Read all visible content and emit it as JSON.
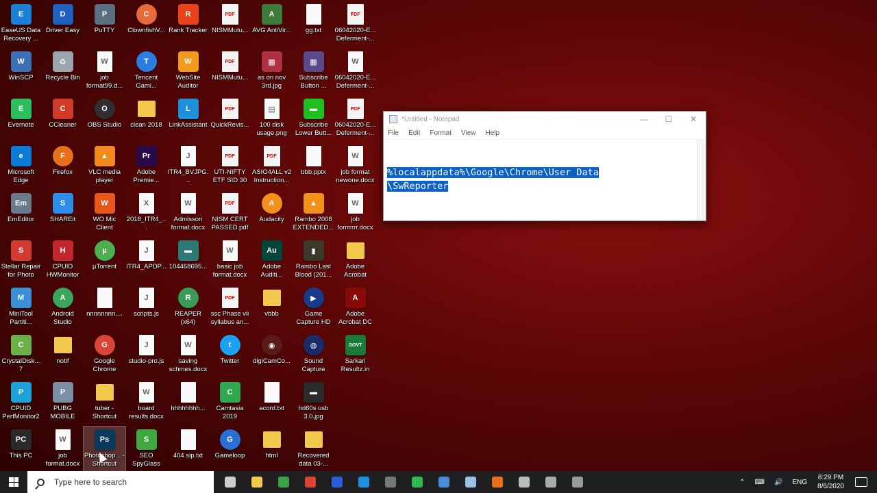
{
  "desktop_icons": [
    {
      "label": "EaseUS Data Recovery ...",
      "name": "easeus-icon",
      "type": "app",
      "color": "#1c7fd6",
      "glyph": "E"
    },
    {
      "label": "WinSCP",
      "name": "winscp-icon",
      "type": "app",
      "color": "#3b6fb6",
      "glyph": "W"
    },
    {
      "label": "Evernote",
      "name": "evernote-icon",
      "type": "app",
      "color": "#2dbe60",
      "glyph": "E"
    },
    {
      "label": "Microsoft Edge",
      "name": "edge-icon",
      "type": "app",
      "color": "#0c7bd8",
      "glyph": "e"
    },
    {
      "label": "EmEditor",
      "name": "emeditor-icon",
      "type": "app",
      "color": "#6a7a8c",
      "glyph": "Em"
    },
    {
      "label": "Stellar Repair for Photo",
      "name": "stellar-icon",
      "type": "app",
      "color": "#d23b2f",
      "glyph": "S"
    },
    {
      "label": "MiniTool Partiti...",
      "name": "minitool-icon",
      "type": "app",
      "color": "#3a8fd6",
      "glyph": "M"
    },
    {
      "label": "CrystalDisk... 7",
      "name": "crystaldisk-icon",
      "type": "app",
      "color": "#6cb04a",
      "glyph": "C"
    },
    {
      "label": "CPUID PerfMonitor2",
      "name": "perfmonitor-icon",
      "type": "app",
      "color": "#1ea3d8",
      "glyph": "P"
    },
    {
      "label": "This PC",
      "name": "this-pc-icon",
      "type": "app",
      "color": "#2a2a2a",
      "glyph": "PC"
    },
    {
      "label": "Driver Easy",
      "name": "drivereasy-icon",
      "type": "app",
      "color": "#1f5fbf",
      "glyph": "D"
    },
    {
      "label": "Recycle Bin",
      "name": "recycle-bin-icon",
      "type": "app",
      "color": "#9aa5b0",
      "glyph": "♻"
    },
    {
      "label": "CCleaner",
      "name": "ccleaner-icon",
      "type": "app",
      "color": "#d13a26",
      "glyph": "C"
    },
    {
      "label": "Firefox",
      "name": "firefox-icon",
      "type": "app",
      "color": "#e8701a",
      "glyph": "F",
      "round": true
    },
    {
      "label": "SHAREit",
      "name": "shareit-icon",
      "type": "app",
      "color": "#2d8fe8",
      "glyph": "S"
    },
    {
      "label": "CPUID HWMonitor",
      "name": "hwmonitor-icon",
      "type": "app",
      "color": "#c4262e",
      "glyph": "H"
    },
    {
      "label": "Android Studio",
      "name": "android-studio-icon",
      "type": "app",
      "color": "#3ca55c",
      "glyph": "A",
      "round": true
    },
    {
      "label": "notif",
      "name": "notif-icon",
      "type": "folder",
      "color": "#f2c94c",
      "glyph": ""
    },
    {
      "label": "PUBG MOBILE",
      "name": "pubg-icon",
      "type": "app",
      "color": "#7a8fa3",
      "glyph": "P"
    },
    {
      "label": "job format.docx",
      "name": "job-format-docx-icon",
      "type": "file",
      "color": "#fafafa",
      "glyph": "W"
    },
    {
      "label": "PuTTY",
      "name": "putty-icon",
      "type": "app",
      "color": "#5b6f82",
      "glyph": "P"
    },
    {
      "label": "job format99.d...",
      "name": "job-format99-icon",
      "type": "file",
      "color": "#fafafa",
      "glyph": "W"
    },
    {
      "label": "OBS Studio",
      "name": "obs-icon",
      "type": "app",
      "color": "#302e31",
      "glyph": "O",
      "round": true
    },
    {
      "label": "VLC media player",
      "name": "vlc-icon",
      "type": "app",
      "color": "#f08a1c",
      "glyph": "▲"
    },
    {
      "label": "WO Mic Client",
      "name": "womic-icon",
      "type": "app",
      "color": "#e8571a",
      "glyph": "W"
    },
    {
      "label": "µTorrent",
      "name": "utorrent-icon",
      "type": "app",
      "color": "#4caf50",
      "glyph": "µ",
      "round": true
    },
    {
      "label": "nnnnnnnn....",
      "name": "nnnnnnnn-icon",
      "type": "file",
      "color": "#fafafa",
      "glyph": ""
    },
    {
      "label": "Google Chrome",
      "name": "chrome-icon",
      "type": "app",
      "color": "#db4437",
      "glyph": "G",
      "round": true
    },
    {
      "label": "tuber - Shortcut",
      "name": "tuber-shortcut-icon",
      "type": "folder",
      "color": "#f2c94c",
      "glyph": ""
    },
    {
      "label": "Photoshop... - Shortcut",
      "name": "photoshop-shortcut-icon",
      "type": "app",
      "color": "#0a3a5c",
      "glyph": "Ps",
      "selected": true
    },
    {
      "label": "ClownfishV...",
      "name": "clownfish-icon",
      "type": "app",
      "color": "#e86a3a",
      "glyph": "C",
      "round": true
    },
    {
      "label": "Tencent Gami...",
      "name": "tencent-icon",
      "type": "app",
      "color": "#2a7de1",
      "glyph": "T",
      "round": true
    },
    {
      "label": "clean 2018",
      "name": "clean-2018-icon",
      "type": "folder",
      "color": "#f2c94c",
      "glyph": ""
    },
    {
      "label": "Adobe Premie...",
      "name": "premiere-icon",
      "type": "app",
      "color": "#2a0a4a",
      "glyph": "Pr"
    },
    {
      "label": "2018_ITR4_...",
      "name": "itr4-2018-icon",
      "type": "file",
      "color": "#fafafa",
      "glyph": "X"
    },
    {
      "label": "ITR4_APDP...",
      "name": "itr4-apdp-icon",
      "type": "file",
      "color": "#fafafa",
      "glyph": "J"
    },
    {
      "label": "scripts.js",
      "name": "scripts-js-icon",
      "type": "file",
      "color": "#fafafa",
      "glyph": "J"
    },
    {
      "label": "studio-pro.js",
      "name": "studio-pro-js-icon",
      "type": "file",
      "color": "#fafafa",
      "glyph": "J"
    },
    {
      "label": "board results.docx",
      "name": "board-results-icon",
      "type": "file",
      "color": "#fafafa",
      "glyph": "W"
    },
    {
      "label": "SEO SpyGlass",
      "name": "seo-spyglass-icon",
      "type": "app",
      "color": "#3fa83f",
      "glyph": "S"
    },
    {
      "label": "Rank Tracker",
      "name": "rank-tracker-icon",
      "type": "app",
      "color": "#e8431a",
      "glyph": "R"
    },
    {
      "label": "WebSite Auditor",
      "name": "website-auditor-icon",
      "type": "app",
      "color": "#f29a1c",
      "glyph": "W"
    },
    {
      "label": "LinkAssistant",
      "name": "linkassistant-icon",
      "type": "app",
      "color": "#1e8fd8",
      "glyph": "L"
    },
    {
      "label": "ITR4_BVJPG...",
      "name": "itr4-bvjpg-icon",
      "type": "file",
      "color": "#fafafa",
      "glyph": "J"
    },
    {
      "label": "Admisson format.docx",
      "name": "admission-format-icon",
      "type": "file",
      "color": "#fafafa",
      "glyph": "W"
    },
    {
      "label": "104468695...",
      "name": "file-104468695-icon",
      "type": "app",
      "color": "#2b7a78",
      "glyph": "▬"
    },
    {
      "label": "REAPER (x64)",
      "name": "reaper-icon",
      "type": "app",
      "color": "#3a9a5a",
      "glyph": "R",
      "round": true
    },
    {
      "label": "saving schmes.docx",
      "name": "saving-schmes-icon",
      "type": "file",
      "color": "#fafafa",
      "glyph": "W"
    },
    {
      "label": "hhhhhhhh...",
      "name": "hhhhhhhh-icon",
      "type": "file",
      "color": "#fafafa",
      "glyph": ""
    },
    {
      "label": "404 sip.txt",
      "name": "404-sip-txt-icon",
      "type": "file",
      "color": "#fafafa",
      "glyph": ""
    },
    {
      "label": "NISMMutu...",
      "name": "nism-mutu-1-icon",
      "type": "doc",
      "color": "#f4f4f4",
      "glyph": "PDF"
    },
    {
      "label": "NISMMutu...",
      "name": "nism-mutu-2-icon",
      "type": "doc",
      "color": "#f4f4f4",
      "glyph": "PDF"
    },
    {
      "label": "QuickRevis...",
      "name": "quickrevis-icon",
      "type": "doc",
      "color": "#f4f4f4",
      "glyph": "PDF"
    },
    {
      "label": "UTI-NIFTY ETF SID 30 ...",
      "name": "uti-nifty-icon",
      "type": "doc",
      "color": "#f4f4f4",
      "glyph": "PDF"
    },
    {
      "label": "NISM CERT PASSED.pdf",
      "name": "nism-cert-icon",
      "type": "doc",
      "color": "#f4f4f4",
      "glyph": "PDF"
    },
    {
      "label": "basic job format.docx",
      "name": "basic-job-format-icon",
      "type": "file",
      "color": "#fafafa",
      "glyph": "W"
    },
    {
      "label": "ssc Phase vii syllabus an...",
      "name": "ssc-phase-icon",
      "type": "doc",
      "color": "#f4f4f4",
      "glyph": "PDF"
    },
    {
      "label": "Twitter",
      "name": "twitter-icon",
      "type": "app",
      "color": "#1da1f2",
      "glyph": "t",
      "round": true
    },
    {
      "label": "Camtasia 2019",
      "name": "camtasia-icon",
      "type": "app",
      "color": "#2fa84f",
      "glyph": "C"
    },
    {
      "label": "Gameloop",
      "name": "gameloop-icon",
      "type": "app",
      "color": "#2a6fd8",
      "glyph": "G",
      "round": true
    },
    {
      "label": "AVG AntiVir...",
      "name": "avg-icon",
      "type": "app",
      "color": "#3f7a3a",
      "glyph": "A"
    },
    {
      "label": "as on nov 3rd.jpg",
      "name": "as-on-nov-icon",
      "type": "app",
      "color": "#b03040",
      "glyph": "▦"
    },
    {
      "label": "100 disk usage.png",
      "name": "disk-usage-icon",
      "type": "file",
      "color": "#fafafa",
      "glyph": "▤"
    },
    {
      "label": "ASIO4ALL v2 Instruction...",
      "name": "asio4all-icon",
      "type": "doc",
      "color": "#f4f4f4",
      "glyph": "PDF"
    },
    {
      "label": "Audacity",
      "name": "audacity-icon",
      "type": "app",
      "color": "#f2901c",
      "glyph": "A",
      "round": true
    },
    {
      "label": "Adobe Auditi...",
      "name": "audition-icon",
      "type": "app",
      "color": "#00463a",
      "glyph": "Au"
    },
    {
      "label": "vbbb",
      "name": "vbbb-icon",
      "type": "folder",
      "color": "#f2c94c",
      "glyph": ""
    },
    {
      "label": "digiCamCo...",
      "name": "digicam-icon",
      "type": "app",
      "color": "#5a1a1a",
      "glyph": "◉",
      "round": true
    },
    {
      "label": "acord.txt",
      "name": "acord-txt-icon",
      "type": "file",
      "color": "#fafafa",
      "glyph": ""
    },
    {
      "label": "html",
      "name": "html-folder-icon",
      "type": "folder",
      "color": "#f2c94c",
      "glyph": ""
    },
    {
      "label": "gg.txt",
      "name": "gg-txt-icon",
      "type": "file",
      "color": "#fafafa",
      "glyph": ""
    },
    {
      "label": "Subscribe Button ...",
      "name": "subscribe-button-icon",
      "type": "app",
      "color": "#5a4a8a",
      "glyph": "▦"
    },
    {
      "label": "Subscribe Lower Butt...",
      "name": "subscribe-lower-icon",
      "type": "app",
      "color": "#20c020",
      "glyph": "▬"
    },
    {
      "label": "bbb.pptx",
      "name": "bbb-pptx-icon",
      "type": "file",
      "color": "#fafafa",
      "glyph": ""
    },
    {
      "label": "Rambo 2008 EXTENDED...",
      "name": "rambo-2008-icon",
      "type": "app",
      "color": "#f2901c",
      "glyph": "▲"
    },
    {
      "label": "Rambo Last Blood (201...",
      "name": "rambo-last-blood-icon",
      "type": "app",
      "color": "#3a3a2a",
      "glyph": "▮"
    },
    {
      "label": "Game Capture HD",
      "name": "game-capture-icon",
      "type": "app",
      "color": "#1a3a8a",
      "glyph": "▶",
      "round": true
    },
    {
      "label": "Sound Capture",
      "name": "sound-capture-icon",
      "type": "app",
      "color": "#1a2a6a",
      "glyph": "◍",
      "round": true
    },
    {
      "label": "hd60s usb 3.0.jpg",
      "name": "hd60s-icon",
      "type": "app",
      "color": "#2a2a2a",
      "glyph": "▬"
    },
    {
      "label": "Recovered data 03-...",
      "name": "recovered-data-icon",
      "type": "folder",
      "color": "#f2c94c",
      "glyph": ""
    },
    {
      "label": "06042020-E... Deferment-...",
      "name": "deferment-1-icon",
      "type": "doc",
      "color": "#f4f4f4",
      "glyph": "PDF"
    },
    {
      "label": "06042020-E... Deferment-...",
      "name": "deferment-2-icon",
      "type": "file",
      "color": "#fafafa",
      "glyph": "W"
    },
    {
      "label": "06042020-E... Deferment-...",
      "name": "deferment-3-icon",
      "type": "doc",
      "color": "#f4f4f4",
      "glyph": "PDF"
    },
    {
      "label": "job format newone.docx",
      "name": "job-format-newone-icon",
      "type": "file",
      "color": "#fafafa",
      "glyph": "W"
    },
    {
      "label": "job forrrrrrr.docx",
      "name": "job-forrrrrrr-icon",
      "type": "file",
      "color": "#fafafa",
      "glyph": "W"
    },
    {
      "label": "Adobe Acrobat",
      "name": "adobe-acrobat-icon",
      "type": "folder",
      "color": "#f2c94c",
      "glyph": ""
    },
    {
      "label": "Adobe Acrobat DC",
      "name": "acrobat-dc-icon",
      "type": "app",
      "color": "#8a0a0a",
      "glyph": "A"
    },
    {
      "label": "Sarkari Resultz.in",
      "name": "sarkari-icon",
      "type": "app",
      "color": "#1a7a3a",
      "glyph": "GOVT"
    }
  ],
  "notepad": {
    "title": "*Untitled - Notepad",
    "menu": [
      "File",
      "Edit",
      "Format",
      "View",
      "Help"
    ],
    "content_line1": "%localappdata%\\Google\\Chrome\\User Data",
    "content_line2": "\\SwReporter"
  },
  "taskbar": {
    "search_placeholder": "Type here to search",
    "apps": [
      {
        "name": "taskbar-task-view-icon",
        "color": "#cccccc"
      },
      {
        "name": "taskbar-file-explorer-icon",
        "color": "#f2c94c"
      },
      {
        "name": "taskbar-app-2-icon",
        "color": "#3aa14a"
      },
      {
        "name": "taskbar-chrome-icon",
        "color": "#db4437"
      },
      {
        "name": "taskbar-app-4-icon",
        "color": "#2a5fd8"
      },
      {
        "name": "taskbar-app-5-icon",
        "color": "#1e8fd8"
      },
      {
        "name": "taskbar-obs-icon",
        "color": "#777777"
      },
      {
        "name": "taskbar-app-7-icon",
        "color": "#2fb84f"
      },
      {
        "name": "taskbar-app-8-icon",
        "color": "#4a8ad8"
      },
      {
        "name": "taskbar-notepad-icon",
        "color": "#9ac0e8"
      },
      {
        "name": "taskbar-firefox-icon",
        "color": "#e8701a"
      },
      {
        "name": "taskbar-app-11-icon",
        "color": "#bbbbbb"
      },
      {
        "name": "taskbar-app-12-icon",
        "color": "#aaaaaa"
      },
      {
        "name": "taskbar-app-13-icon",
        "color": "#999999"
      }
    ],
    "language": "ENG",
    "time": "8:29 PM",
    "date": "8/6/2020"
  }
}
